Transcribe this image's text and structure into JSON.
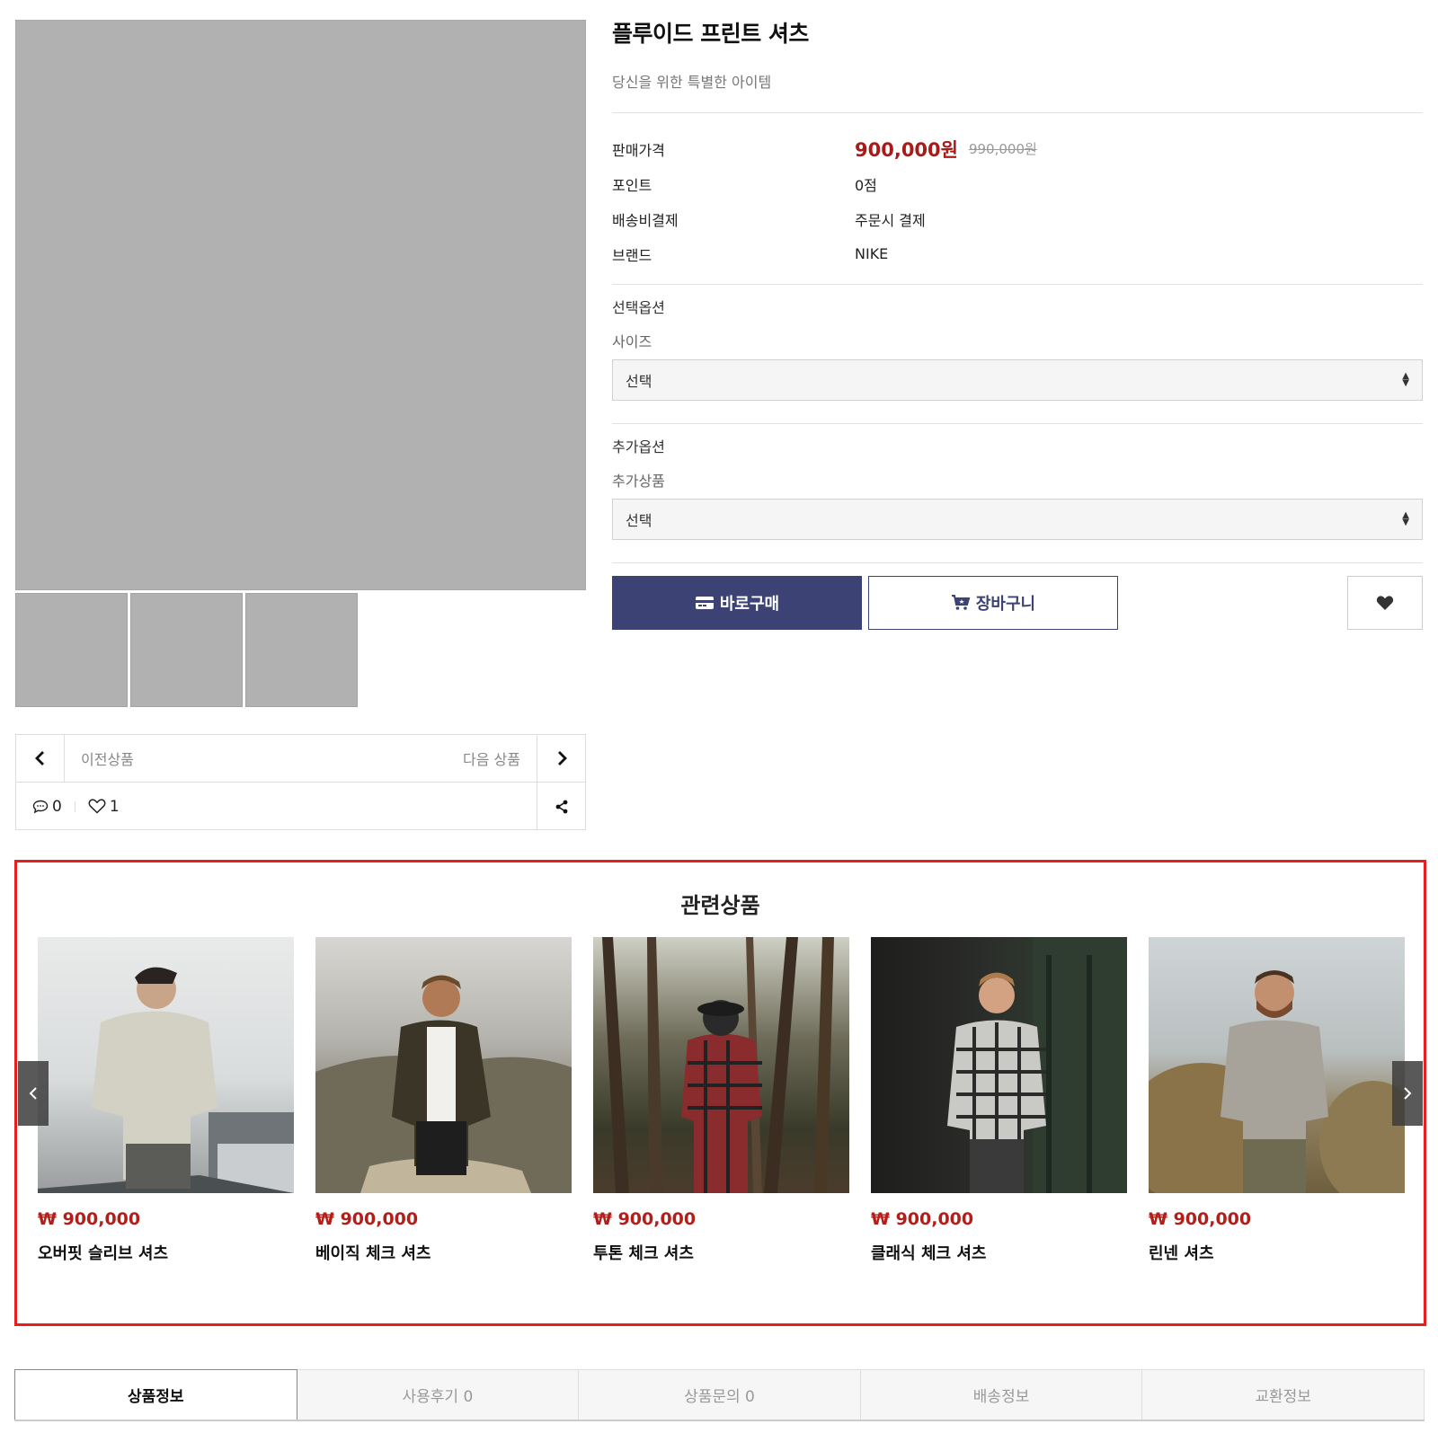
{
  "product": {
    "title": "플루이드 프린트 셔츠",
    "subtitle": "당신을 위한 특별한 아이템"
  },
  "specs": [
    {
      "label": "판매가격",
      "value": "900,000원",
      "old_value": "990,000원"
    },
    {
      "label": "포인트",
      "value": "0점"
    },
    {
      "label": "배송비결제",
      "value": "주문시 결제"
    },
    {
      "label": "브랜드",
      "value": "NIKE"
    }
  ],
  "options": {
    "select_heading": "선택옵션",
    "size_label": "사이즈",
    "size_value": "선택",
    "extra_heading": "추가옵션",
    "extra_label": "추가상품",
    "extra_value": "선택"
  },
  "buttons": {
    "buy": "바로구매",
    "cart": "장바구니"
  },
  "nav": {
    "prev": "이전상품",
    "next": "다음 상품",
    "comments": "0",
    "likes": "1"
  },
  "related": {
    "title": "관련상품",
    "items": [
      {
        "price": "₩ 900,000",
        "name": "오버핏 슬리브 셔츠"
      },
      {
        "price": "₩ 900,000",
        "name": "베이직 체크 셔츠"
      },
      {
        "price": "₩ 900,000",
        "name": "투톤 체크 셔츠"
      },
      {
        "price": "₩ 900,000",
        "name": "클래식 체크 셔츠"
      },
      {
        "price": "₩ 900,000",
        "name": "린넨 셔츠"
      }
    ]
  },
  "tabs": [
    "상품정보",
    "사용후기 0",
    "상품문의 0",
    "배송정보",
    "교환정보"
  ],
  "colors": {
    "accent": "#3d4274",
    "price_red": "#a91b18",
    "highlight_border": "#e51e1e"
  }
}
